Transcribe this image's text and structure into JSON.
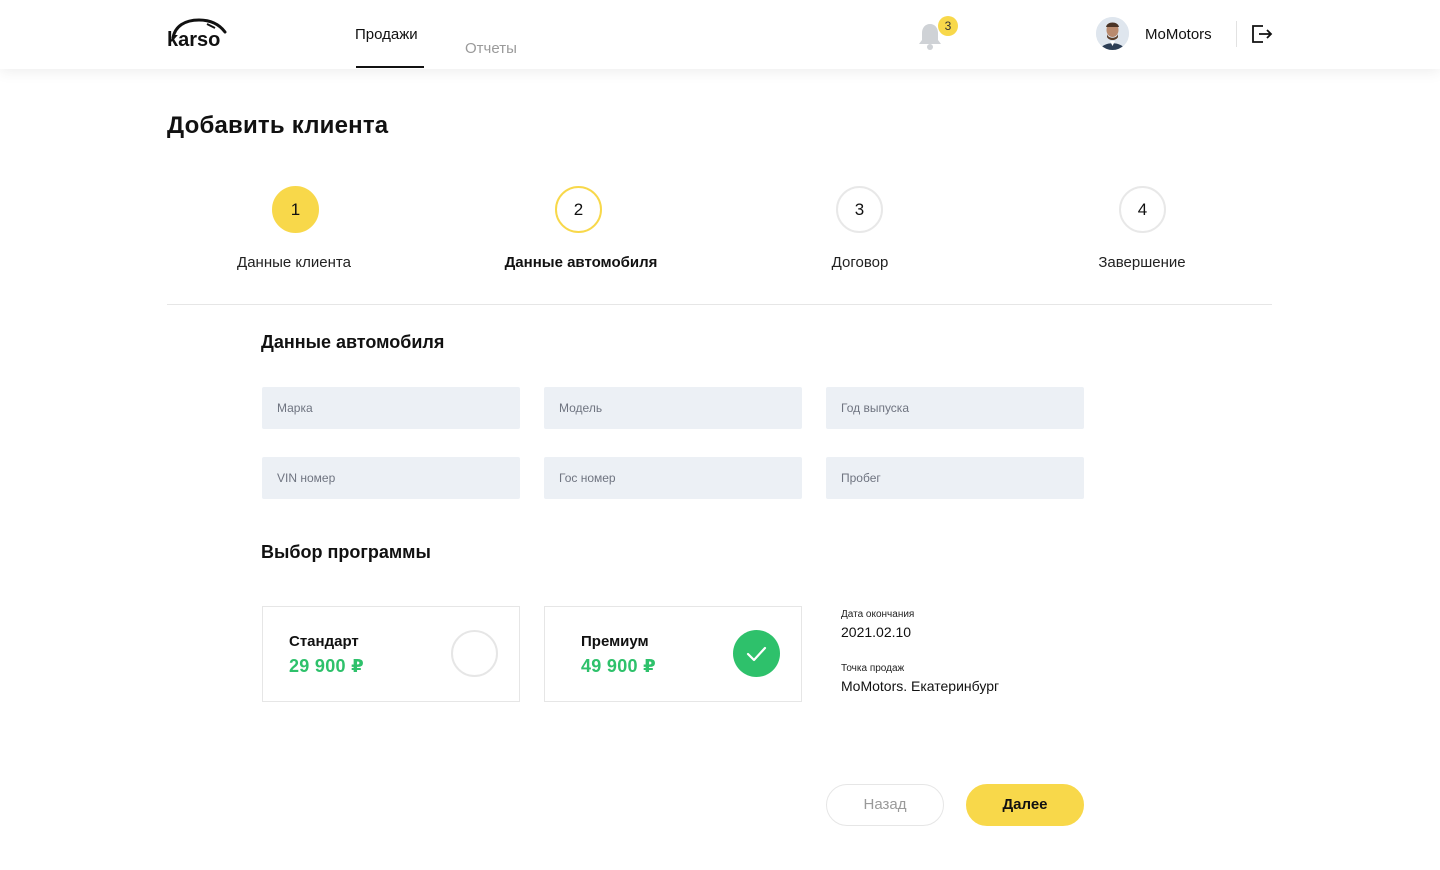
{
  "header": {
    "logo_text": "karso",
    "nav": [
      {
        "label": "Продажи",
        "active": true
      },
      {
        "label": "Отчеты",
        "active": false
      }
    ],
    "notifications_count": "3",
    "user_name": "MoMotors",
    "icons": [
      "bell-icon",
      "avatar",
      "logout-icon"
    ]
  },
  "page_title": "Добавить клиента",
  "steps": [
    {
      "number": "1",
      "label": "Данные клиента",
      "state": "done"
    },
    {
      "number": "2",
      "label": "Данные автомобиля",
      "state": "current"
    },
    {
      "number": "3",
      "label": "Договор",
      "state": "pending"
    },
    {
      "number": "4",
      "label": "Завершение",
      "state": "pending"
    }
  ],
  "car_section": {
    "title": "Данные автомобиля",
    "fields": [
      {
        "placeholder": "Марка",
        "value": ""
      },
      {
        "placeholder": "Модель",
        "value": ""
      },
      {
        "placeholder": "Год выпуска",
        "value": ""
      },
      {
        "placeholder": "VIN номер",
        "value": ""
      },
      {
        "placeholder": "Гос номер",
        "value": ""
      },
      {
        "placeholder": "Пробег",
        "value": ""
      }
    ]
  },
  "program_section": {
    "title": "Выбор программы",
    "programs": [
      {
        "name": "Стандарт",
        "price": "29 900 ₽",
        "selected": false
      },
      {
        "name": "Премиум",
        "price": "49 900 ₽",
        "selected": true
      }
    ],
    "end_date_label": "Дата окончания",
    "end_date_value": "2021.02.10",
    "point_of_sale_label": "Точка продаж",
    "point_of_sale_value": "MoMotors. Екатеринбург"
  },
  "buttons": {
    "back": "Назад",
    "next": "Далее"
  },
  "colors": {
    "accent_yellow": "#f8d84a",
    "success_green": "#2ec16b",
    "field_bg": "#ecf0f5"
  }
}
